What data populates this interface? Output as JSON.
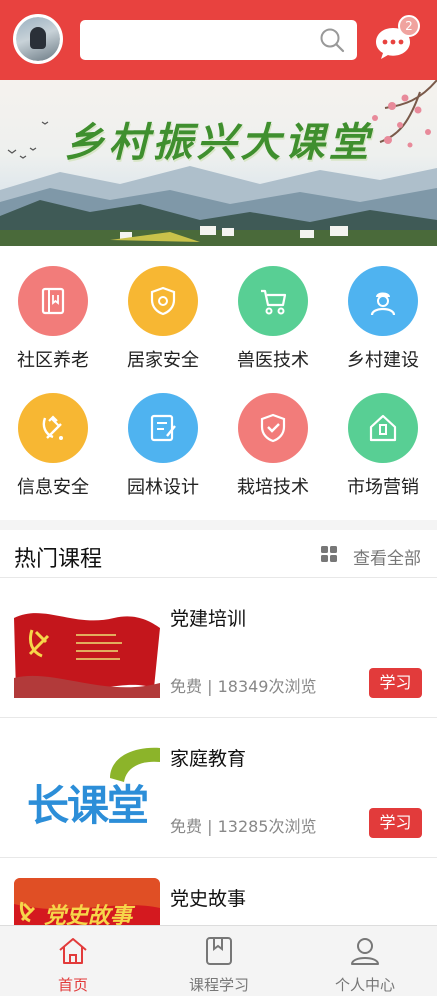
{
  "header": {
    "search": {
      "placeholder": ""
    },
    "message_badge": "2"
  },
  "banner": {
    "title": "乡村振兴大课堂"
  },
  "categories": [
    {
      "label": "社区养老",
      "icon": "book-icon",
      "color": "#f27c7a"
    },
    {
      "label": "居家安全",
      "icon": "shield-icon",
      "color": "#f7b733"
    },
    {
      "label": "兽医技术",
      "icon": "stroller-icon",
      "color": "#58cf94"
    },
    {
      "label": "乡村建设",
      "icon": "worker-icon",
      "color": "#4fb3f0"
    },
    {
      "label": "信息安全",
      "icon": "party-emblem-icon",
      "color": "#f7b733"
    },
    {
      "label": "园林设计",
      "icon": "edit-document-icon",
      "color": "#4fb3f0"
    },
    {
      "label": "栽培技术",
      "icon": "check-shield-icon",
      "color": "#f27c7a"
    },
    {
      "label": "市场营销",
      "icon": "home-pin-icon",
      "color": "#58cf94"
    }
  ],
  "hot": {
    "title": "热门课程",
    "view_all": "查看全部",
    "courses": [
      {
        "title": "党建培训",
        "price": "免费",
        "views": "18349次浏览",
        "action": "学习"
      },
      {
        "title": "家庭教育",
        "price": "免费",
        "views": "13285次浏览",
        "action": "学习",
        "thumb_text": "长课堂"
      },
      {
        "title": "党史故事",
        "thumb_text": "党史故事"
      }
    ]
  },
  "tabs": [
    {
      "label": "首页",
      "icon": "home-icon",
      "active": true
    },
    {
      "label": "课程学习",
      "icon": "bookmark-book-icon",
      "active": false
    },
    {
      "label": "个人中心",
      "icon": "user-icon",
      "active": false
    }
  ],
  "colors": {
    "primary": "#e8423f",
    "button": "#e23b3b"
  }
}
